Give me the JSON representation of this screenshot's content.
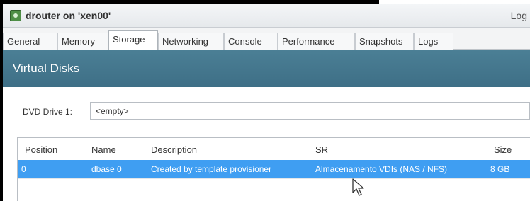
{
  "window": {
    "title": "drouter on 'xen00'",
    "right_link": "Log"
  },
  "tabs": [
    {
      "label": "General"
    },
    {
      "label": "Memory"
    },
    {
      "label": "Storage"
    },
    {
      "label": "Networking"
    },
    {
      "label": "Console"
    },
    {
      "label": "Performance"
    },
    {
      "label": "Snapshots"
    },
    {
      "label": "Logs"
    }
  ],
  "active_tab": "Storage",
  "banner": {
    "title": "Virtual Disks"
  },
  "dvd": {
    "label": "DVD Drive 1:",
    "value": "<empty>"
  },
  "table": {
    "columns": [
      "Position",
      "Name",
      "Description",
      "SR",
      "Size"
    ],
    "rows": [
      {
        "position": "0",
        "name": "dbase 0",
        "description": "Created by template provisioner",
        "sr": "Almacenamento VDIs (NAS / NFS)",
        "size": "8 GB",
        "selected": true
      }
    ]
  },
  "colors": {
    "banner": "#3e6f86",
    "selection": "#3f9ef2",
    "app_icon": "#4e8f46"
  }
}
